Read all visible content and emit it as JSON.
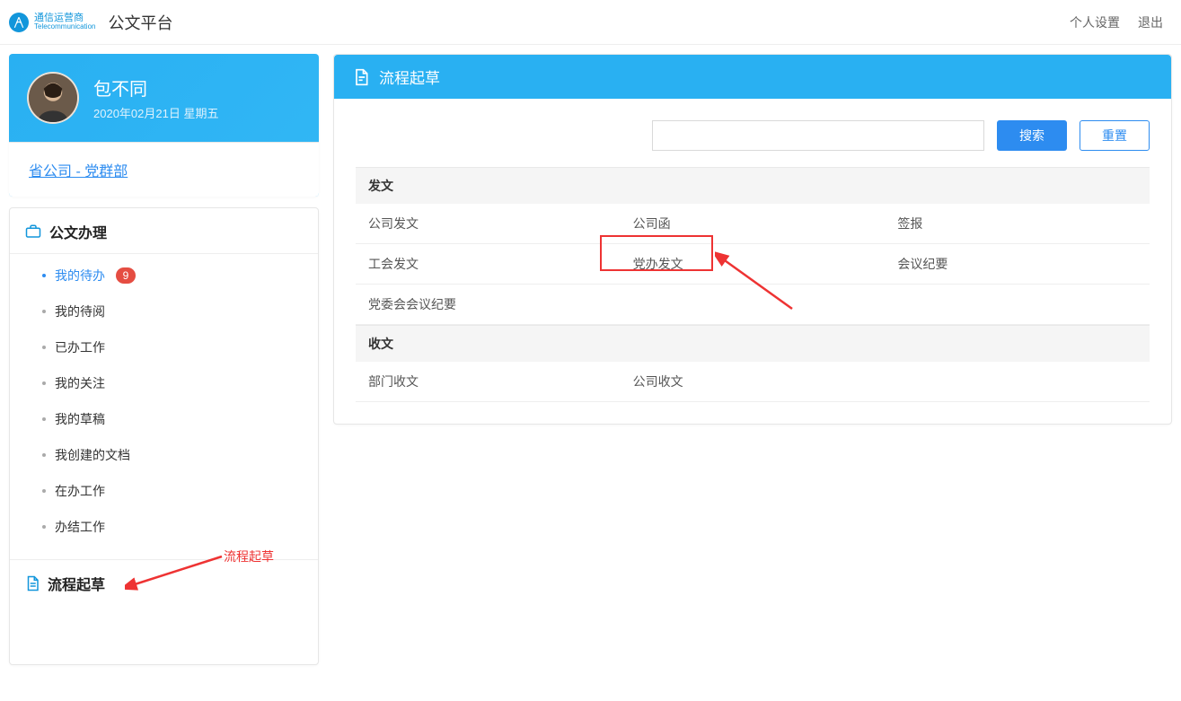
{
  "topbar": {
    "logo_cn": "通信运营商",
    "logo_en": "Telecommunication",
    "app_title": "公文平台",
    "settings": "个人设置",
    "logout": "退出"
  },
  "user": {
    "name": "包不同",
    "date": "2020年02月21日 星期五",
    "org": "省公司 - 党群部"
  },
  "nav": {
    "section1": "公文办理",
    "items": [
      {
        "label": "我的待办",
        "badge": "9",
        "active": true
      },
      {
        "label": "我的待阅"
      },
      {
        "label": "已办工作"
      },
      {
        "label": "我的关注"
      },
      {
        "label": "我的草稿"
      },
      {
        "label": "我创建的文档"
      },
      {
        "label": "在办工作"
      },
      {
        "label": "办结工作"
      }
    ],
    "section2": "流程起草",
    "annotation": "流程起草"
  },
  "main": {
    "title": "流程起草",
    "search_btn": "搜索",
    "reset_btn": "重置",
    "groups": [
      {
        "header": "发文",
        "rows": [
          [
            "公司发文",
            "公司函",
            "签报"
          ],
          [
            "工会发文",
            "党办发文",
            "会议纪要"
          ],
          [
            "党委会会议纪要",
            "",
            ""
          ]
        ]
      },
      {
        "header": "收文",
        "rows": [
          [
            "部门收文",
            "公司收文",
            ""
          ]
        ]
      }
    ]
  }
}
